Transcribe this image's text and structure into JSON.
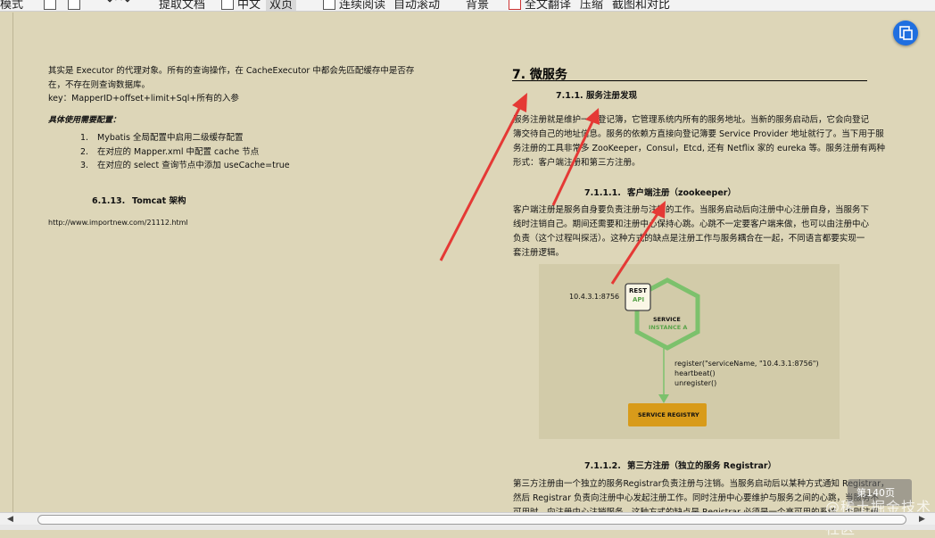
{
  "toolbar": {
    "items": [
      "模式",
      "提取文档",
      "中文",
      "双页",
      "连续阅读",
      "自动滚动",
      "背景",
      "全文翻译",
      "压缩",
      "截图和对比"
    ]
  },
  "left_page": {
    "para1_line1": "其实是  Executor 的代理对象。所有的查询操作，在  CacheExecutor 中都会先匹配缓存中是否存",
    "para1_line2": "在，不存在则查询数据库。",
    "para1_line3": "key：MapperID+offset+limit+Sql+所有的入参",
    "config_heading": "具体使用需要配置：",
    "list": [
      {
        "num": "1.",
        "text": "Mybatis 全局配置中启用二级缓存配置"
      },
      {
        "num": "2.",
        "text": "在对应的 Mapper.xml 中配置 cache 节点"
      },
      {
        "num": "3.",
        "text": "在对应的 select 查询节点中添加 useCache=true"
      }
    ],
    "section_num": "6.1.13.",
    "section_title": "Tomcat 架构",
    "link": "http://www.importnew.com/21112.html"
  },
  "right_page": {
    "chapter": "7.   微服务",
    "sub1_num": "7.1.1.",
    "sub1_title": "服务注册发现",
    "p1": [
      "服务注册就是维护一个登记簿，它管理系统内所有的服务地址。当新的服务启动后，它会向登记",
      "簿交待自己的地址信息。服务的依赖方直接向登记簿要 Service Provider 地址就行了。当下用于服",
      "务注册的工具非常多 ZooKeeper，Consul，Etcd, 还有 Netflix 家的 eureka 等。服务注册有两种",
      "形式：客户端注册和第三方注册。"
    ],
    "sub2_num": "7.1.1.1.",
    "sub2_title": "客户端注册（zookeeper）",
    "p2": [
      "客户端注册是服务自身要负责注册与注销的工作。当服务启动后向注册中心注册自身，当服务下",
      "线时注销自己。期间还需要和注册中心保持心跳。心跳不一定要客户端来做，也可以由注册中心",
      "负责（这个过程叫探活）。这种方式的缺点是注册工作与服务耦合在一起，不同语言都要实现一",
      "套注册逻辑。"
    ],
    "sub3_num": "7.1.1.2.",
    "sub3_title": "第三方注册（独立的服务 Registrar）",
    "p3": [
      "第三方注册由一个独立的服务Registrar负责注册与注销。当服务启动后以某种方式通知 Registrar，",
      "然后 Registrar 负责向注册中心发起注册工作。同时注册中心要维护与服务之间的心跳，当服务不",
      "可用时，向注册中心注销服务。这种方式的缺点是 Registrar 必须是一个高可用的系统，否则注册"
    ]
  },
  "diagram": {
    "ip": "10.4.3.1:8756",
    "rest": "REST",
    "api": "API",
    "service": "SERVICE",
    "instance": "INSTANCE A",
    "code1": "register(\"serviceName, \"10.4.3.1:8756\")",
    "code2": "heartbeat()",
    "code3": "unregister()",
    "registry": "SERVICE REGISTRY",
    "hex_color": "#7cc16c",
    "registry_color": "#d89b1a"
  },
  "overlay": {
    "page_count": "第140页",
    "watermark": "@稀土掘金技术社区"
  }
}
